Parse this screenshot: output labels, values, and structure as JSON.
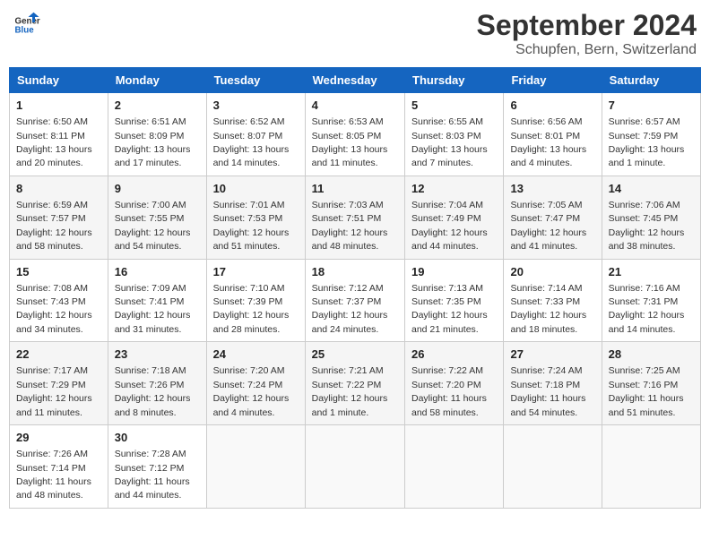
{
  "header": {
    "logo_general": "General",
    "logo_blue": "Blue",
    "month": "September 2024",
    "location": "Schupfen, Bern, Switzerland"
  },
  "days_of_week": [
    "Sunday",
    "Monday",
    "Tuesday",
    "Wednesday",
    "Thursday",
    "Friday",
    "Saturday"
  ],
  "weeks": [
    [
      {
        "day": "1",
        "sunrise": "6:50 AM",
        "sunset": "8:11 PM",
        "daylight": "13 hours and 20 minutes."
      },
      {
        "day": "2",
        "sunrise": "6:51 AM",
        "sunset": "8:09 PM",
        "daylight": "13 hours and 17 minutes."
      },
      {
        "day": "3",
        "sunrise": "6:52 AM",
        "sunset": "8:07 PM",
        "daylight": "13 hours and 14 minutes."
      },
      {
        "day": "4",
        "sunrise": "6:53 AM",
        "sunset": "8:05 PM",
        "daylight": "13 hours and 11 minutes."
      },
      {
        "day": "5",
        "sunrise": "6:55 AM",
        "sunset": "8:03 PM",
        "daylight": "13 hours and 7 minutes."
      },
      {
        "day": "6",
        "sunrise": "6:56 AM",
        "sunset": "8:01 PM",
        "daylight": "13 hours and 4 minutes."
      },
      {
        "day": "7",
        "sunrise": "6:57 AM",
        "sunset": "7:59 PM",
        "daylight": "13 hours and 1 minute."
      }
    ],
    [
      {
        "day": "8",
        "sunrise": "6:59 AM",
        "sunset": "7:57 PM",
        "daylight": "12 hours and 58 minutes."
      },
      {
        "day": "9",
        "sunrise": "7:00 AM",
        "sunset": "7:55 PM",
        "daylight": "12 hours and 54 minutes."
      },
      {
        "day": "10",
        "sunrise": "7:01 AM",
        "sunset": "7:53 PM",
        "daylight": "12 hours and 51 minutes."
      },
      {
        "day": "11",
        "sunrise": "7:03 AM",
        "sunset": "7:51 PM",
        "daylight": "12 hours and 48 minutes."
      },
      {
        "day": "12",
        "sunrise": "7:04 AM",
        "sunset": "7:49 PM",
        "daylight": "12 hours and 44 minutes."
      },
      {
        "day": "13",
        "sunrise": "7:05 AM",
        "sunset": "7:47 PM",
        "daylight": "12 hours and 41 minutes."
      },
      {
        "day": "14",
        "sunrise": "7:06 AM",
        "sunset": "7:45 PM",
        "daylight": "12 hours and 38 minutes."
      }
    ],
    [
      {
        "day": "15",
        "sunrise": "7:08 AM",
        "sunset": "7:43 PM",
        "daylight": "12 hours and 34 minutes."
      },
      {
        "day": "16",
        "sunrise": "7:09 AM",
        "sunset": "7:41 PM",
        "daylight": "12 hours and 31 minutes."
      },
      {
        "day": "17",
        "sunrise": "7:10 AM",
        "sunset": "7:39 PM",
        "daylight": "12 hours and 28 minutes."
      },
      {
        "day": "18",
        "sunrise": "7:12 AM",
        "sunset": "7:37 PM",
        "daylight": "12 hours and 24 minutes."
      },
      {
        "day": "19",
        "sunrise": "7:13 AM",
        "sunset": "7:35 PM",
        "daylight": "12 hours and 21 minutes."
      },
      {
        "day": "20",
        "sunrise": "7:14 AM",
        "sunset": "7:33 PM",
        "daylight": "12 hours and 18 minutes."
      },
      {
        "day": "21",
        "sunrise": "7:16 AM",
        "sunset": "7:31 PM",
        "daylight": "12 hours and 14 minutes."
      }
    ],
    [
      {
        "day": "22",
        "sunrise": "7:17 AM",
        "sunset": "7:29 PM",
        "daylight": "12 hours and 11 minutes."
      },
      {
        "day": "23",
        "sunrise": "7:18 AM",
        "sunset": "7:26 PM",
        "daylight": "12 hours and 8 minutes."
      },
      {
        "day": "24",
        "sunrise": "7:20 AM",
        "sunset": "7:24 PM",
        "daylight": "12 hours and 4 minutes."
      },
      {
        "day": "25",
        "sunrise": "7:21 AM",
        "sunset": "7:22 PM",
        "daylight": "12 hours and 1 minute."
      },
      {
        "day": "26",
        "sunrise": "7:22 AM",
        "sunset": "7:20 PM",
        "daylight": "11 hours and 58 minutes."
      },
      {
        "day": "27",
        "sunrise": "7:24 AM",
        "sunset": "7:18 PM",
        "daylight": "11 hours and 54 minutes."
      },
      {
        "day": "28",
        "sunrise": "7:25 AM",
        "sunset": "7:16 PM",
        "daylight": "11 hours and 51 minutes."
      }
    ],
    [
      {
        "day": "29",
        "sunrise": "7:26 AM",
        "sunset": "7:14 PM",
        "daylight": "11 hours and 48 minutes."
      },
      {
        "day": "30",
        "sunrise": "7:28 AM",
        "sunset": "7:12 PM",
        "daylight": "11 hours and 44 minutes."
      },
      null,
      null,
      null,
      null,
      null
    ]
  ],
  "labels": {
    "sunrise_prefix": "Sunrise: ",
    "sunset_prefix": "Sunset: ",
    "daylight_prefix": "Daylight: "
  }
}
